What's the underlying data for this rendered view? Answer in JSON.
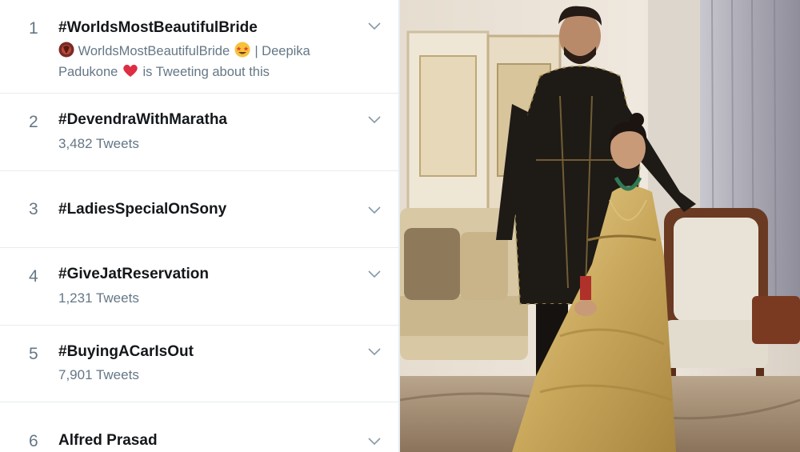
{
  "trends": [
    {
      "rank": "1",
      "name": "#WorldsMostBeautifulBride",
      "context": {
        "account": "WorldsMostBeautifulBride",
        "separator": "| Deepika",
        "line2": "Padukone",
        "suffix": "is Tweeting about this"
      }
    },
    {
      "rank": "2",
      "name": "#DevendraWithMaratha",
      "tweets": "3,482 Tweets"
    },
    {
      "rank": "3",
      "name": "#LadiesSpecialOnSony"
    },
    {
      "rank": "4",
      "name": "#GiveJatReservation",
      "tweets": "1,231 Tweets"
    },
    {
      "rank": "5",
      "name": "#BuyingACarIsOut",
      "tweets": "7,901 Tweets"
    },
    {
      "rank": "6",
      "name": "Alfred Prasad"
    }
  ],
  "icons": {
    "chevron": "chevron-down-icon",
    "star_struck": "star-struck-emoji-icon",
    "heart": "red-heart-emoji-icon",
    "account_avatar": "account-avatar-icon"
  },
  "colors": {
    "text_primary": "#14171a",
    "text_secondary": "#657786",
    "divider": "#e6ecf0",
    "gold": "#c9a85c",
    "jacket": "#1e1a16"
  }
}
